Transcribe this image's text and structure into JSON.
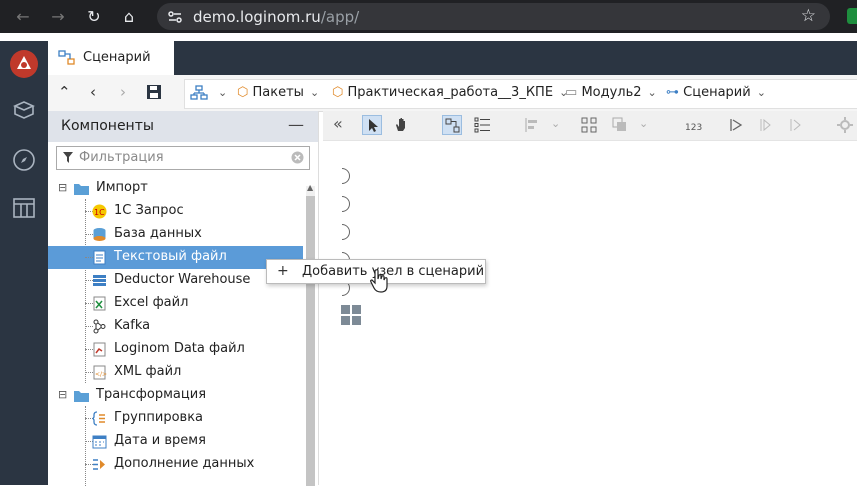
{
  "browser": {
    "url_host": "demo.loginom.ru",
    "url_path": "/app/"
  },
  "tabs": [
    {
      "label": "Сценарий",
      "active": true
    }
  ],
  "breadcrumbs": [
    {
      "label": "Пакеты",
      "icon": "package-icon"
    },
    {
      "label": "Практическая_работа__3_КПЕ",
      "icon": "package-icon"
    },
    {
      "label": "Модуль2",
      "icon": "module-icon"
    },
    {
      "label": "Сценарий",
      "icon": "scenario-icon"
    }
  ],
  "panel": {
    "title": "Компоненты",
    "minimize": "—",
    "filter_placeholder": "Фильтрация"
  },
  "tree": {
    "groups": [
      {
        "label": "Импорт",
        "items": [
          {
            "label": "1С Запрос",
            "icon": "1c-icon"
          },
          {
            "label": "База данных",
            "icon": "database-icon"
          },
          {
            "label": "Текстовый файл",
            "icon": "text-file-icon",
            "selected": true
          },
          {
            "label": "Deductor Warehouse",
            "icon": "warehouse-icon"
          },
          {
            "label": "Excel файл",
            "icon": "excel-icon"
          },
          {
            "label": "Kafka",
            "icon": "kafka-icon"
          },
          {
            "label": "Loginom Data файл",
            "icon": "loginom-data-icon"
          },
          {
            "label": "XML файл",
            "icon": "xml-icon"
          }
        ]
      },
      {
        "label": "Трансформация",
        "items": [
          {
            "label": "Группировка",
            "icon": "grouping-icon"
          },
          {
            "label": "Дата и время",
            "icon": "calendar-icon"
          },
          {
            "label": "Дополнение данных",
            "icon": "data-supplement-icon"
          }
        ]
      }
    ]
  },
  "context_menu": {
    "plus": "+",
    "label": "Добавить узел в сценарий"
  },
  "colors": {
    "app_dark": "#2b3542",
    "selection": "#5b9bd8",
    "panel_header": "#dfe3ea"
  }
}
